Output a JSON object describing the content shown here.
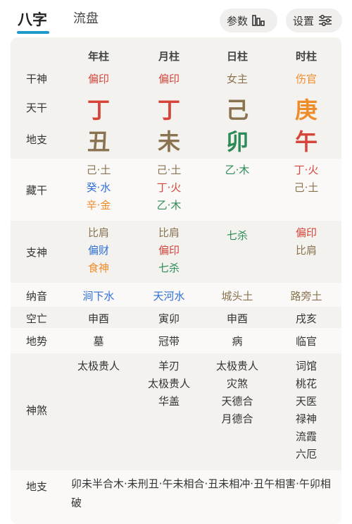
{
  "tabs": {
    "active": "八字",
    "inactive": "流盘"
  },
  "buttons": {
    "params": "参数",
    "settings": "设置"
  },
  "columns": [
    "年柱",
    "月柱",
    "日柱",
    "时柱"
  ],
  "rows": {
    "ganshen": {
      "label": "干神",
      "values": [
        "偏印",
        "偏印",
        "女主",
        "伤官"
      ]
    },
    "tiangan": {
      "label": "天干",
      "values": [
        "丁",
        "丁",
        "己",
        "庚"
      ]
    },
    "dizhi": {
      "label": "地支",
      "values": [
        "丑",
        "未",
        "卯",
        "午"
      ]
    },
    "canggan": {
      "label": "藏干",
      "values": [
        [
          "己·土",
          "癸·水",
          "辛·金"
        ],
        [
          "己·土",
          "丁·火",
          "乙·木"
        ],
        [
          "乙·木"
        ],
        [
          "丁·火",
          "己·土"
        ]
      ]
    },
    "zhishen": {
      "label": "支神",
      "values": [
        [
          "比肩",
          "偏财",
          "食神"
        ],
        [
          "比肩",
          "偏印",
          "七杀"
        ],
        [
          "七杀"
        ],
        [
          "偏印",
          "比肩"
        ]
      ]
    },
    "nayin": {
      "label": "纳音",
      "values": [
        "涧下水",
        "天河水",
        "城头土",
        "路旁土"
      ]
    },
    "kongwang": {
      "label": "空亡",
      "values": [
        "申酉",
        "寅卯",
        "申酉",
        "戌亥"
      ]
    },
    "dishi": {
      "label": "地势",
      "values": [
        "墓",
        "冠带",
        "病",
        "临官"
      ]
    },
    "shensha": {
      "label": "神煞",
      "values": [
        [
          "太极贵人"
        ],
        [
          "羊刃",
          "太极贵人",
          "华盖"
        ],
        [
          "太极贵人",
          "灾煞",
          "天德合",
          "月德合"
        ],
        [
          "词馆",
          "桃花",
          "天医",
          "禄神",
          "流霞",
          "六厄"
        ]
      ]
    },
    "relations": {
      "label": "地支",
      "text": "卯未半合木·未刑丑·午未相合·丑未相冲·丑午相害·午卯相破"
    }
  },
  "colors": {
    "accent": "#1e9bc8",
    "red": "#d6453a",
    "brown": "#8a7350",
    "green": "#2e8b57",
    "orange": "#ef8c2a",
    "blue": "#2f6fd6"
  }
}
